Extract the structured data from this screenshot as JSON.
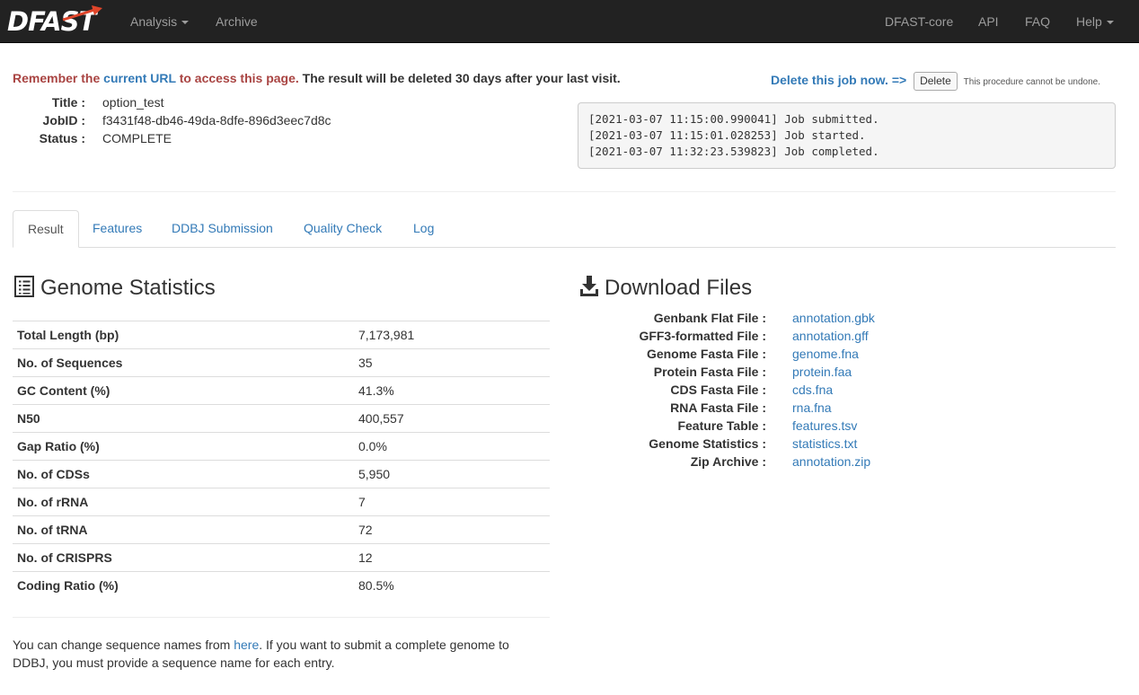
{
  "navbar": {
    "brand": "DFAST",
    "left_items": [
      {
        "label": "Analysis",
        "dropdown": true
      },
      {
        "label": "Archive",
        "dropdown": false
      }
    ],
    "right_items": [
      {
        "label": "DFAST-core",
        "dropdown": false
      },
      {
        "label": "API",
        "dropdown": false
      },
      {
        "label": "FAQ",
        "dropdown": false
      },
      {
        "label": "Help",
        "dropdown": true
      }
    ]
  },
  "notice": {
    "part1": "Remember the ",
    "link": "current URL",
    "part2": " to access this page.",
    "part3": " The result will be deleted 30 days after your last visit."
  },
  "job": {
    "title_label": "Title :",
    "title": "option_test",
    "jobid_label": "JobID :",
    "jobid": "f3431f48-db46-49da-8dfe-896d3eec7d8c",
    "status_label": "Status :",
    "status": "COMPLETE"
  },
  "delete": {
    "link": "Delete this job now. =>",
    "button": "Delete",
    "note": "This procedure cannot be undone."
  },
  "log": [
    "[2021-03-07 11:15:00.990041] Job submitted.",
    "[2021-03-07 11:15:01.028253] Job started.",
    "[2021-03-07 11:32:23.539823] Job completed."
  ],
  "tabs": [
    "Result",
    "Features",
    "DDBJ Submission",
    "Quality Check",
    "Log"
  ],
  "active_tab": "Result",
  "genome_statistics": {
    "title": "Genome Statistics",
    "rows": [
      {
        "key": "Total Length (bp)",
        "value": "7,173,981"
      },
      {
        "key": "No. of Sequences",
        "value": "35"
      },
      {
        "key": "GC Content (%)",
        "value": "41.3%"
      },
      {
        "key": "N50",
        "value": "400,557"
      },
      {
        "key": "Gap Ratio (%)",
        "value": "0.0%"
      },
      {
        "key": "No. of CDSs",
        "value": "5,950"
      },
      {
        "key": "No. of rRNA",
        "value": "7"
      },
      {
        "key": "No. of tRNA",
        "value": "72"
      },
      {
        "key": "No. of CRISPRS",
        "value": "12"
      },
      {
        "key": "Coding Ratio (%)",
        "value": "80.5%"
      }
    ]
  },
  "footnote": {
    "part1": "You can change sequence names from ",
    "link": "here",
    "part2": ". If you want to submit a complete genome to DDBJ, you must provide a sequence name for each entry."
  },
  "downloads": {
    "title": "Download Files",
    "items": [
      {
        "label": "Genbank Flat File :",
        "file": "annotation.gbk"
      },
      {
        "label": "GFF3-formatted File :",
        "file": "annotation.gff"
      },
      {
        "label": "Genome Fasta File :",
        "file": "genome.fna"
      },
      {
        "label": "Protein Fasta File :",
        "file": "protein.faa"
      },
      {
        "label": "CDS Fasta File :",
        "file": "cds.fna"
      },
      {
        "label": "RNA Fasta File :",
        "file": "rna.fna"
      },
      {
        "label": "Feature Table :",
        "file": "features.tsv"
      },
      {
        "label": "Genome Statistics :",
        "file": "statistics.txt"
      },
      {
        "label": "Zip Archive :",
        "file": "annotation.zip"
      }
    ]
  },
  "colors": {
    "navbar_bg": "#222222",
    "nav_text": "#9d9d9d",
    "link": "#337ab7",
    "warning": "#a94442",
    "brand_arrow": "#e0452a"
  }
}
